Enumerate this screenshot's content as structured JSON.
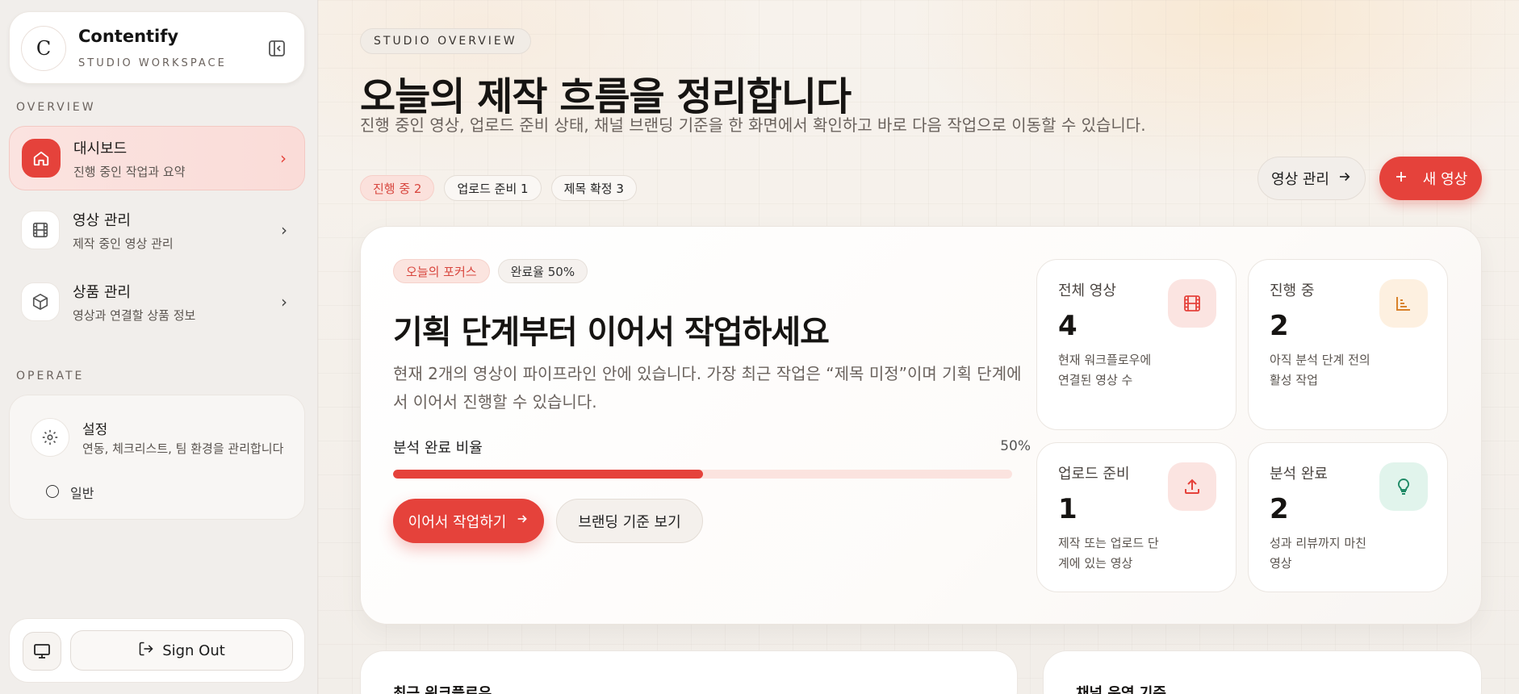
{
  "brand": {
    "logo_letter": "C",
    "name": "Contentify",
    "subtitle": "STUDIO WORKSPACE"
  },
  "sidebar": {
    "overview_label": "OVERVIEW",
    "items": [
      {
        "label": "대시보드",
        "sub": "진행 중인 작업과 요약",
        "icon": "home-icon"
      },
      {
        "label": "영상 관리",
        "sub": "제작 중인 영상 관리",
        "icon": "film-icon"
      },
      {
        "label": "상품 관리",
        "sub": "영상과 연결할 상품 정보",
        "icon": "package-icon"
      }
    ],
    "operate_label": "OPERATE",
    "settings": {
      "label": "설정",
      "sub": "연동, 체크리스트, 팀 환경을 관리합니다",
      "option": "일반"
    },
    "signout": "Sign Out"
  },
  "header": {
    "eyebrow": "STUDIO OVERVIEW",
    "title": "오늘의 제작 흐름을 정리합니다",
    "description": "진행 중인 영상, 업로드 준비 상태, 채널 브랜딩 기준을 한 화면에서 확인하고 바로 다음 작업으로 이동할 수 있습니다.",
    "tags": [
      "진행 중 2",
      "업로드 준비 1",
      "제목 확정 3"
    ],
    "manage_button": "영상 관리",
    "new_button": "새 영상"
  },
  "focus": {
    "tag1": "오늘의 포커스",
    "tag2": "완료율 50%",
    "title": "기획 단계부터 이어서 작업하세요",
    "description": "현재 2개의 영상이 파이프라인 안에 있습니다. 가장 최근 작업은 “제목 미정”이며 기획 단계에서 이어서 진행할 수 있습니다.",
    "progress_label": "분석 완료 비율",
    "progress_text": "50%",
    "progress_value": 0.5,
    "continue_button": "이어서 작업하기",
    "branding_button": "브랜딩 기준 보기"
  },
  "stats": [
    {
      "label": "전체 영상",
      "value": "4",
      "desc": "현재 워크플로우에 연결된 영상 수",
      "icon": "film-icon",
      "color": "#e5423b",
      "bg": "#fbe4e1"
    },
    {
      "label": "진행 중",
      "value": "2",
      "desc": "아직 분석 단계 전의 활성 작업",
      "icon": "bar-chart-icon",
      "color": "#d9822b",
      "bg": "#fdf0e0"
    },
    {
      "label": "업로드 준비",
      "value": "1",
      "desc": "제작 또는 업로드 단계에 있는 영상",
      "icon": "upload-icon",
      "color": "#e5423b",
      "bg": "#fbe4e1"
    },
    {
      "label": "분석 완료",
      "value": "2",
      "desc": "성과 리뷰까지 마친 영상",
      "icon": "lightbulb-icon",
      "color": "#1f8a66",
      "bg": "#e1f4ec"
    }
  ],
  "lower": {
    "workflow_title": "최근 워크플로우",
    "channel_title": "채널 운영 기준"
  }
}
